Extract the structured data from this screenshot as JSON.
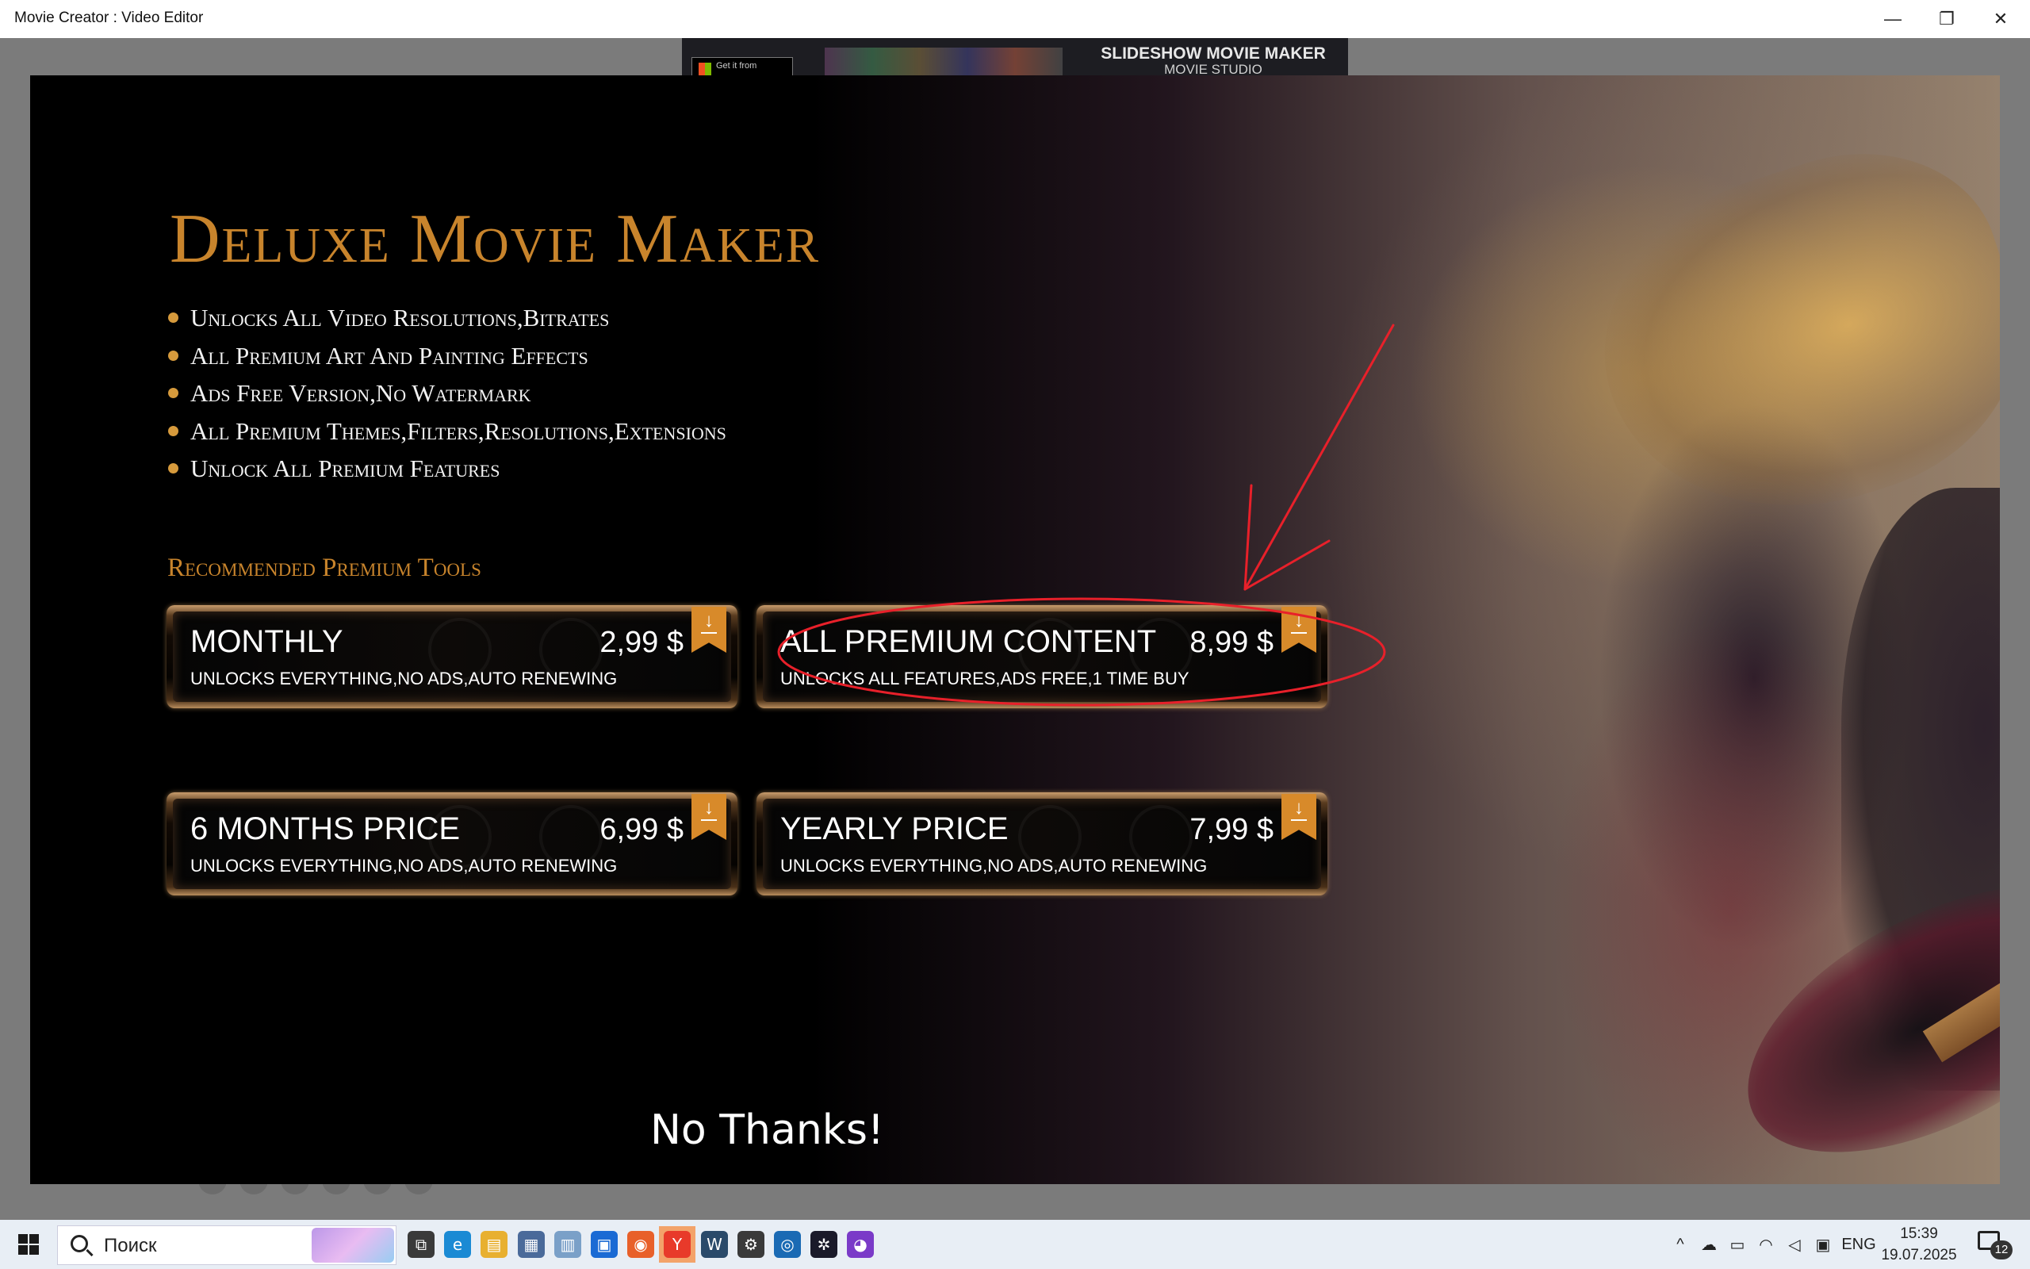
{
  "window": {
    "title": "Movie Creator : Video Editor",
    "controls": {
      "minimize": "—",
      "restore": "❐",
      "close": "✕"
    }
  },
  "banner": {
    "store_badge": "Get it from",
    "title_line1": "SLIDESHOW MOVIE MAKER",
    "title_line2": "MOVIE STUDIO"
  },
  "dialog": {
    "headline": "Deluxe Movie Maker",
    "features": [
      "Unlocks All Video Resolutions,Bitrates",
      "All Premium Art And Painting Effects",
      "Ads Free Version,No Watermark",
      "All Premium Themes,Filters,Resolutions,Extensions",
      "Unlock All Premium Features"
    ],
    "recommended_title": "Recommended Premium Tools",
    "plans": [
      {
        "name": "MONTHLY",
        "price": "2,99 $",
        "description": "UNLOCKS EVERYTHING,NO ADS,AUTO RENEWING"
      },
      {
        "name": "ALL PREMIUM CONTENT",
        "price": "8,99 $",
        "description": "UNLOCKS ALL FEATURES,ADS FREE,1 TIME BUY"
      },
      {
        "name": "6 MONTHS PRICE",
        "price": "6,99 $",
        "description": "UNLOCKS EVERYTHING,NO ADS,AUTO RENEWING"
      },
      {
        "name": "YEARLY PRICE",
        "price": "7,99 $",
        "description": "UNLOCKS EVERYTHING,NO ADS,AUTO RENEWING"
      }
    ],
    "decline_label": "No Thanks!",
    "accent_color": "#c8842c",
    "ribbon_color": "#d88a2a"
  },
  "annotation": {
    "color": "#e8202a",
    "highlighted_plan": "ALL PREMIUM CONTENT"
  },
  "taskbar": {
    "search_placeholder": "Поиск",
    "apps": [
      {
        "name": "task-view-icon",
        "glyph": "⧉",
        "color": "#3a3a3a",
        "active": false
      },
      {
        "name": "edge-icon",
        "glyph": "e",
        "color": "#1a8ad4",
        "active": false
      },
      {
        "name": "file-explorer-icon",
        "glyph": "▤",
        "color": "#e8b030",
        "active": false
      },
      {
        "name": "calculator-icon",
        "glyph": "▦",
        "color": "#4a6a9a",
        "active": false
      },
      {
        "name": "notepad-icon",
        "glyph": "▥",
        "color": "#7aa0c8",
        "active": false
      },
      {
        "name": "store-icon",
        "glyph": "▣",
        "color": "#1a6ad4",
        "active": false
      },
      {
        "name": "firefox-icon",
        "glyph": "◉",
        "color": "#e8602a",
        "active": false
      },
      {
        "name": "yandex-browser-icon",
        "glyph": "Y",
        "color": "#e83a2a",
        "active": true
      },
      {
        "name": "wikipedia-app-icon",
        "glyph": "W",
        "color": "#2a4a6a",
        "active": false
      },
      {
        "name": "settings-icon",
        "glyph": "⚙",
        "color": "#3a3a3a",
        "active": false
      },
      {
        "name": "photo-viewer-icon",
        "glyph": "◎",
        "color": "#1a6ab4",
        "active": false
      },
      {
        "name": "movie-creator-icon",
        "glyph": "✲",
        "color": "#1a1a2a",
        "active": false
      },
      {
        "name": "mascot-app-icon",
        "glyph": "◕",
        "color": "#7a3ac8",
        "active": false
      }
    ],
    "tray": {
      "chevron": "^",
      "language": "ENG",
      "time": "15:39",
      "date": "19.07.2025",
      "notifications_count": "12"
    }
  }
}
